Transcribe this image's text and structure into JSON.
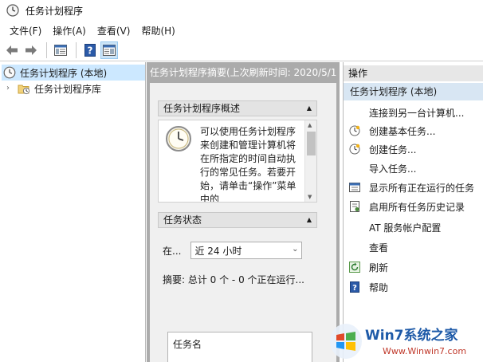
{
  "window": {
    "title": "任务计划程序"
  },
  "menu": {
    "items": [
      "文件(F)",
      "操作(A)",
      "查看(V)",
      "帮助(H)"
    ]
  },
  "tree": {
    "root_label": "任务计划程序 (本地)",
    "child_label": "任务计划程序库"
  },
  "middle": {
    "header": "任务计划程序摘要(上次刷新时间: 2020/5/1",
    "overview_title": "任务计划程序概述",
    "overview_text": "可以使用任务计划程序来创建和管理计算机将在所指定的时间自动执行的常见任务。若要开始，请单击“操作”菜单中的",
    "status_title": "任务状态",
    "status_label": "在...",
    "status_value": "近 24 小时",
    "summary": "摘要: 总计 0 个 - 0 个正在运行...",
    "task_name_header": "任务名"
  },
  "actions": {
    "header": "操作",
    "subheader": "任务计划程序 (本地)",
    "items": [
      {
        "label": "连接到另一台计算机...",
        "icon": "none"
      },
      {
        "label": "创建基本任务...",
        "icon": "clock-star-icon"
      },
      {
        "label": "创建任务...",
        "icon": "clock-star-icon"
      },
      {
        "label": "导入任务...",
        "icon": "none"
      },
      {
        "label": "显示所有正在运行的任务",
        "icon": "running-tasks-icon"
      },
      {
        "label": "启用所有任务历史记录",
        "icon": "history-icon"
      },
      {
        "label": "AT 服务帐户配置",
        "icon": "none"
      },
      {
        "label": "查看",
        "icon": "none"
      },
      {
        "label": "刷新",
        "icon": "refresh-icon"
      },
      {
        "label": "帮助",
        "icon": "help-icon"
      }
    ]
  },
  "watermark": {
    "brand": "Win7系统之家",
    "url": "Www.Winwin7.com"
  },
  "colors": {
    "accent": "#1c6fc8",
    "selection": "#cce8ff",
    "middle_bg": "#ababab"
  }
}
